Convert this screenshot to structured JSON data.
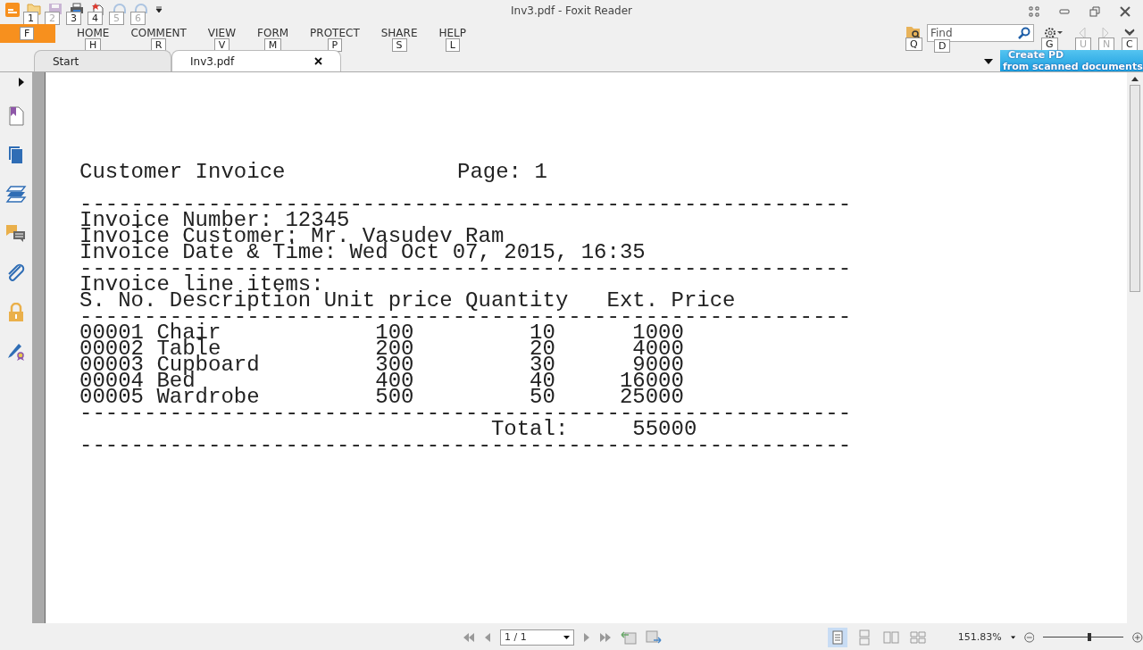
{
  "app": {
    "title": "Inv3.pdf - Foxit Reader"
  },
  "quick_access": [
    {
      "kind": "open",
      "keytip": "1",
      "disabled": false
    },
    {
      "kind": "save",
      "keytip": "2",
      "disabled": true
    },
    {
      "kind": "print",
      "keytip": "3",
      "disabled": false
    },
    {
      "kind": "new",
      "keytip": "4",
      "disabled": false
    },
    {
      "kind": "undo",
      "keytip": "5",
      "disabled": true
    },
    {
      "kind": "redo",
      "keytip": "6",
      "disabled": true
    }
  ],
  "file_tab": {
    "keytip": "F"
  },
  "ribbon_tabs": [
    {
      "label": "HOME",
      "keytip": "H"
    },
    {
      "label": "COMMENT",
      "keytip": "R"
    },
    {
      "label": "VIEW",
      "keytip": "V"
    },
    {
      "label": "FORM",
      "keytip": "M"
    },
    {
      "label": "PROTECT",
      "keytip": "P"
    },
    {
      "label": "SHARE",
      "keytip": "S"
    },
    {
      "label": "HELP",
      "keytip": "L"
    }
  ],
  "search": {
    "folder_keytip": "Q",
    "placeholder": "Find",
    "keytip": "D"
  },
  "tools": [
    {
      "kind": "gear",
      "keytip": "G",
      "disabled": false
    },
    {
      "kind": "prev",
      "keytip": "U",
      "disabled": true
    },
    {
      "kind": "next",
      "keytip": "N",
      "disabled": true
    },
    {
      "kind": "collapse",
      "keytip": "C",
      "disabled": false
    }
  ],
  "doc_tabs": [
    {
      "label": "Start",
      "selected": false
    },
    {
      "label": "Inv3.pdf",
      "selected": true
    }
  ],
  "banner": {
    "lines": [
      "Create PD",
      "from scanned documents"
    ]
  },
  "sidebar": [
    {
      "kind": "bookmark"
    },
    {
      "kind": "pages"
    },
    {
      "kind": "layers"
    },
    {
      "kind": "comments"
    },
    {
      "kind": "attachment"
    },
    {
      "kind": "security"
    },
    {
      "kind": "signature"
    }
  ],
  "document": {
    "title": "Customer Invoice",
    "page": "Page: 1",
    "lines": [
      "------------------------------------------------------------",
      "Invoice Number: 12345",
      "Invoice Customer: Mr. Vasudev Ram",
      "Invoice Date & Time: Wed Oct 07, 2015, 16:35",
      "------------------------------------------------------------",
      "Invoice line items:",
      "S. No. Description Unit price Quantity   Ext. Price",
      "------------------------------------------------------------",
      "00001 Chair            100         10      1000",
      "00002 Table            200         20      4000",
      "00003 Cupboard         300         30      9000",
      "00004 Bed              400         40     16000",
      "00005 Wardrobe         500         50     25000",
      "------------------------------------------------------------",
      "                                Total:     55000",
      "------------------------------------------------------------"
    ]
  },
  "status": {
    "page": "1 / 1",
    "zoom": "151.83%",
    "zoom_slider": {
      "level": 0.57
    },
    "view_modes": [
      {
        "kind": "single",
        "selected": true
      },
      {
        "kind": "continuous",
        "selected": false
      },
      {
        "kind": "facing",
        "selected": false
      },
      {
        "kind": "cont-facing",
        "selected": false
      }
    ]
  }
}
